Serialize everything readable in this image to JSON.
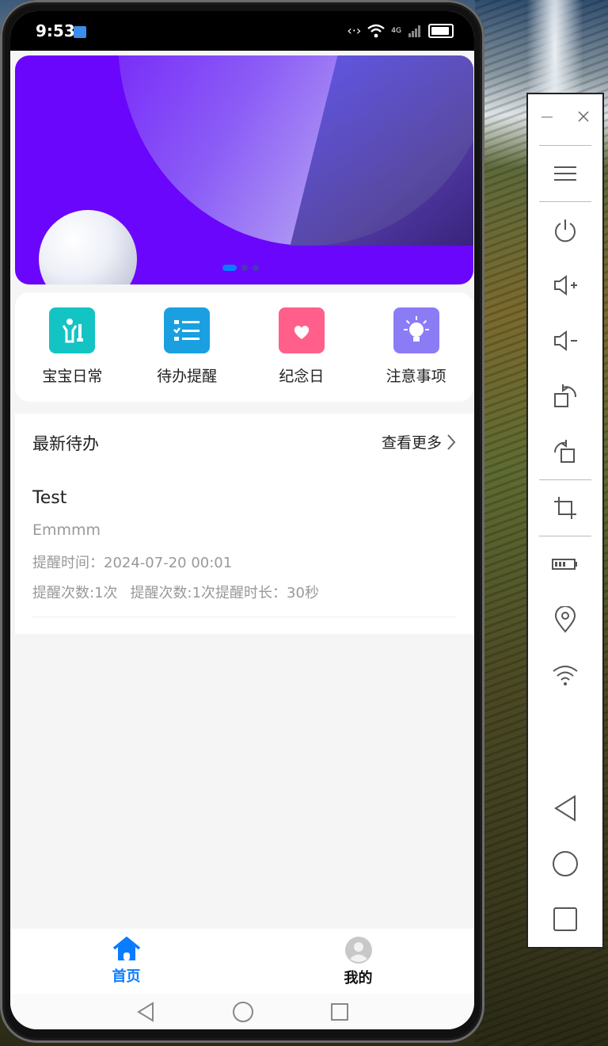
{
  "status": {
    "time": "9:53",
    "network": "4G"
  },
  "banner": {
    "slides": 3,
    "active_index": 0
  },
  "shortcuts": [
    {
      "label": "宝宝日常",
      "icon": "baby-icon",
      "color": "#14c4c4"
    },
    {
      "label": "待办提醒",
      "icon": "checklist-icon",
      "color": "#1aa0e0"
    },
    {
      "label": "纪念日",
      "icon": "calendar-heart-icon",
      "color": "#ff5f8a"
    },
    {
      "label": "注意事项",
      "icon": "lightbulb-icon",
      "color": "#8b7cf6"
    }
  ],
  "todos": {
    "header": "最新待办",
    "more_label": "查看更多",
    "items": [
      {
        "title": "Test",
        "desc": "Emmmm",
        "time": "提醒时间：2024-07-20 00:01",
        "count": "提醒次数:1次",
        "count_duration": "提醒次数:1次提醒时长：30秒"
      }
    ]
  },
  "tabbar": {
    "tabs": [
      {
        "label": "首页",
        "icon": "home-icon",
        "active": true
      },
      {
        "label": "我的",
        "icon": "user-avatar-icon",
        "active": false
      }
    ],
    "active_color": "#0a7cff"
  },
  "emulator_toolbar": {
    "buttons": [
      "minimize-icon",
      "close-icon",
      "menu-icon",
      "power-icon",
      "volume-up-icon",
      "volume-down-icon",
      "rotate-left-icon",
      "rotate-right-icon",
      "crop-icon",
      "battery-icon",
      "location-icon",
      "wifi-icon",
      "back-icon",
      "home-circle-icon",
      "overview-icon"
    ]
  }
}
